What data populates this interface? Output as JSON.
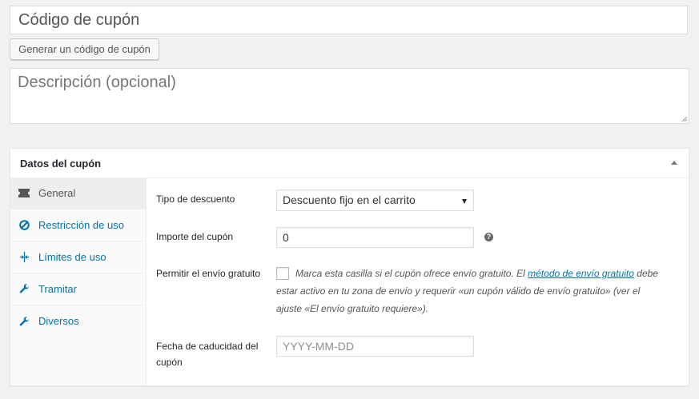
{
  "coupon": {
    "code_value": "Código de cupón",
    "generate_button": "Generar un código de cupón",
    "description_placeholder": "Descripción (opcional)"
  },
  "panel": {
    "title": "Datos del cupón",
    "tabs": [
      {
        "label": "General",
        "icon": "ticket-icon",
        "active": true
      },
      {
        "label": "Restricción de uso",
        "icon": "forbidden-icon"
      },
      {
        "label": "Límites de uso",
        "icon": "limits-icon"
      },
      {
        "label": "Tramitar",
        "icon": "wrench-icon"
      },
      {
        "label": "Diversos",
        "icon": "wrench-icon"
      }
    ]
  },
  "general": {
    "discount_type_label": "Tipo de descuento",
    "discount_type_value": "Descuento fijo en el carrito",
    "amount_label": "Importe del cupón",
    "amount_value": "0",
    "free_shipping_label": "Permitir el envío gratuito",
    "free_shipping_desc_1": "Marca esta casilla si el cupón ofrece envío gratuito. El ",
    "free_shipping_link": "método de envío gratuito",
    "free_shipping_desc_2": "debe estar activo en tu zona de envío y requerir «un cupón válido de envío gratuito» (ver el ajuste «El envío gratuito requiere»).",
    "expiry_label_1": "Fecha de caducidad del",
    "expiry_label_2": "cupón",
    "expiry_placeholder": "YYYY-MM-DD"
  },
  "colors": {
    "link": "#0073aa",
    "background": "#f1f1f1"
  }
}
